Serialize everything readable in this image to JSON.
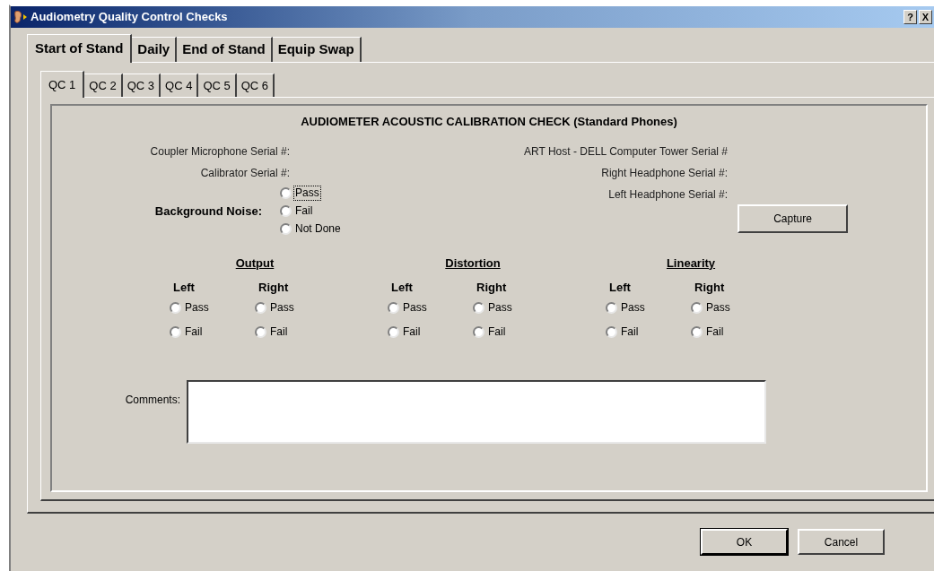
{
  "window": {
    "title": "Audiometry Quality Control Checks",
    "help_button": "?",
    "close_button": "X"
  },
  "tabs": [
    {
      "label": "Start of Stand",
      "selected": true
    },
    {
      "label": "Daily",
      "selected": false
    },
    {
      "label": "End of Stand",
      "selected": false
    },
    {
      "label": "Equip Swap",
      "selected": false
    }
  ],
  "subtabs": [
    {
      "label": "QC 1",
      "selected": true
    },
    {
      "label": "QC 2",
      "selected": false
    },
    {
      "label": "QC 3",
      "selected": false
    },
    {
      "label": "QC 4",
      "selected": false
    },
    {
      "label": "QC 5",
      "selected": false
    },
    {
      "label": "QC 6",
      "selected": false
    }
  ],
  "panel": {
    "title": "AUDIOMETER ACOUSTIC CALIBRATION CHECK (Standard Phones)",
    "serial_labels_left": [
      "Coupler Microphone Serial #:",
      "Calibrator Serial #:"
    ],
    "serial_labels_right": [
      "ART Host - DELL Computer Tower Serial #",
      "Right Headphone Serial #:",
      "Left Headphone Serial #:"
    ],
    "background_noise": {
      "label": "Background Noise:",
      "options": [
        {
          "label": "Pass",
          "selected": false,
          "focused": true
        },
        {
          "label": "Fail",
          "selected": false,
          "focused": false
        },
        {
          "label": "Not Done",
          "selected": false,
          "focused": false
        }
      ]
    },
    "capture_button": "Capture",
    "checks": [
      {
        "heading": "Output",
        "sides": [
          {
            "label": "Left",
            "options": [
              {
                "label": "Pass",
                "selected": false
              },
              {
                "label": "Fail",
                "selected": false
              }
            ]
          },
          {
            "label": "Right",
            "options": [
              {
                "label": "Pass",
                "selected": false
              },
              {
                "label": "Fail",
                "selected": false
              }
            ]
          }
        ]
      },
      {
        "heading": "Distortion",
        "sides": [
          {
            "label": "Left",
            "options": [
              {
                "label": "Pass",
                "selected": false
              },
              {
                "label": "Fail",
                "selected": false
              }
            ]
          },
          {
            "label": "Right",
            "options": [
              {
                "label": "Pass",
                "selected": false
              },
              {
                "label": "Fail",
                "selected": false
              }
            ]
          }
        ]
      },
      {
        "heading": "Linearity",
        "sides": [
          {
            "label": "Left",
            "options": [
              {
                "label": "Pass",
                "selected": false
              },
              {
                "label": "Fail",
                "selected": false
              }
            ]
          },
          {
            "label": "Right",
            "options": [
              {
                "label": "Pass",
                "selected": false
              },
              {
                "label": "Fail",
                "selected": false
              }
            ]
          }
        ]
      }
    ],
    "comments_label": "Comments:"
  },
  "buttons": [
    {
      "label": "OK",
      "default": true
    },
    {
      "label": "Cancel",
      "default": false
    }
  ]
}
